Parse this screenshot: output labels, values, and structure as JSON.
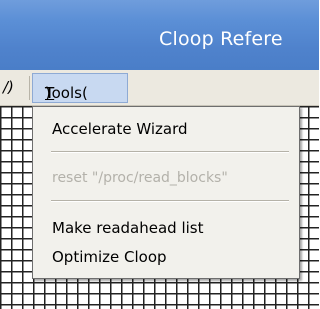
{
  "window": {
    "title": "Cloop Refere"
  },
  "menubar": {
    "partial_item": "/)",
    "tools_label_prefix": "Tools(",
    "tools_label_key": "T",
    "tools_label_suffix": ")"
  },
  "tools_menu": {
    "items": [
      {
        "label": "Accelerate Wizard",
        "enabled": true
      },
      {
        "label": "reset \"/proc/read_blocks\"",
        "enabled": false
      },
      {
        "label": "Make readahead list",
        "enabled": true
      },
      {
        "label": "Optimize Cloop",
        "enabled": true
      }
    ]
  }
}
